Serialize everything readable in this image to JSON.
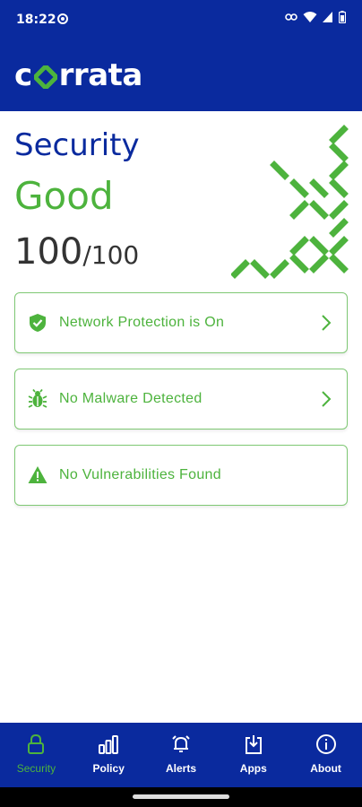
{
  "status_bar": {
    "time": "18:22"
  },
  "app": {
    "logo_text_pre": "c",
    "logo_text_post": "rrata"
  },
  "security": {
    "title": "Security",
    "status": "Good",
    "score": "100",
    "score_total": "/100"
  },
  "cards": [
    {
      "label": "Network Protection is On",
      "icon": "shield-check-icon",
      "has_chevron": true
    },
    {
      "label": "No Malware Detected",
      "icon": "bug-icon",
      "has_chevron": true
    },
    {
      "label": "No Vulnerabilities Found",
      "icon": "warning-triangle-icon",
      "has_chevron": false
    }
  ],
  "bottom_nav": [
    {
      "label": "Security",
      "icon": "lock-icon",
      "active": true
    },
    {
      "label": "Policy",
      "icon": "bar-chart-icon",
      "active": false
    },
    {
      "label": "Alerts",
      "icon": "alarm-bell-icon",
      "active": false
    },
    {
      "label": "Apps",
      "icon": "download-icon",
      "active": false
    },
    {
      "label": "About",
      "icon": "info-icon",
      "active": false
    }
  ],
  "colors": {
    "brand_blue": "#0a2a9e",
    "brand_green": "#4db33d",
    "card_border": "#7fc874"
  }
}
